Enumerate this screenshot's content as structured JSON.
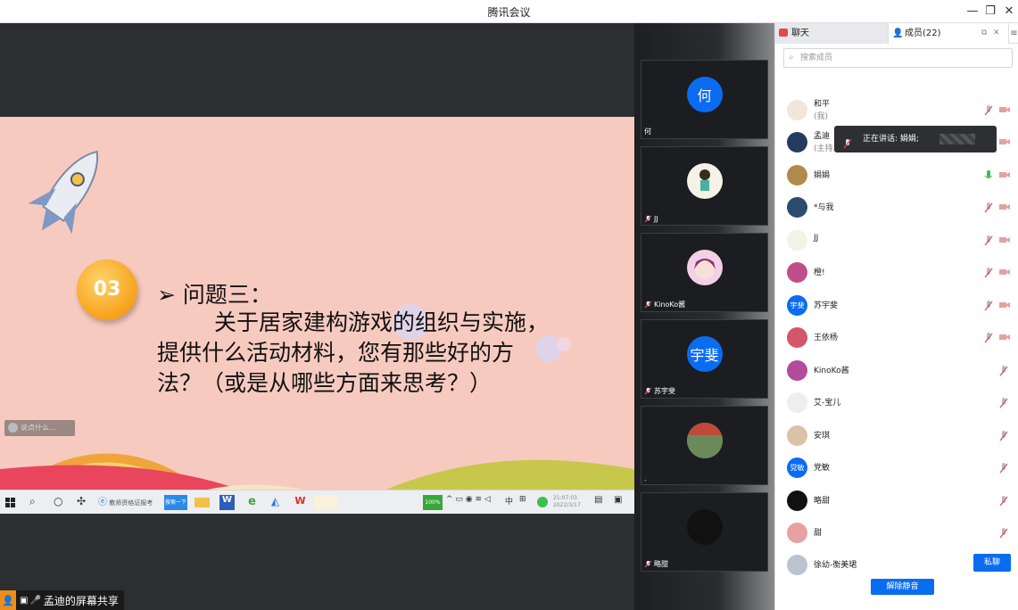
{
  "window": {
    "title": "腾讯会议",
    "controls": {
      "minimize": "—",
      "restore": "❐",
      "close": "✕"
    }
  },
  "slide": {
    "badge": "03",
    "heading": "➢ 问题三：",
    "body_line1": "关于居家建构游戏的组织与实施，",
    "body_line2": "提供什么活动材料，您有那些好的方",
    "body_line3": "法？（或是从哪些方面来思考？）",
    "chat_hint": "说点什么…",
    "taskbar": {
      "search_btn": "搜索一下",
      "tab_label": "教师资格证报考",
      "battery": "100%",
      "ime": "中",
      "time": "21:07:03",
      "date": "2022/3/17"
    }
  },
  "share_label": "孟迪的屏幕共享",
  "video_tiles": [
    {
      "avatar_text": "何",
      "name": "何",
      "color": "#0a6cf0"
    },
    {
      "avatar_text": "",
      "name": "JJ",
      "color": "#f4f1e6"
    },
    {
      "avatar_text": "",
      "name": "KinoKo酱",
      "color": "#f2d0e6"
    },
    {
      "avatar_text": "宇斐",
      "name": "苏宇斐",
      "color": "#0a6cf0"
    },
    {
      "avatar_text": "",
      "name": ".",
      "color": "#8d8a80"
    },
    {
      "avatar_text": "",
      "name": "略甜",
      "color": "#111111"
    }
  ],
  "panel": {
    "tab_chat": "聊天",
    "tab_members": "成员(22)",
    "search_placeholder": "搜索成员",
    "tooltip": "正在讲话: 娟娟;",
    "members": [
      {
        "name": "和平",
        "role": "(我)",
        "av": "#f2e6d8"
      },
      {
        "name": "孟迪",
        "role": "(主持人)",
        "av": "#243a5e"
      },
      {
        "name": "娟娟",
        "role": "",
        "av": "#b08a4a"
      },
      {
        "name": "*与我",
        "role": "",
        "av": "#2b4c6e"
      },
      {
        "name": "JJ",
        "role": "",
        "av": "#f4f1e6"
      },
      {
        "name": "橙!",
        "role": "",
        "av": "#c04e8a"
      },
      {
        "name": "苏宇斐",
        "role": "",
        "av": "#0a6cf0",
        "text": "宇斐"
      },
      {
        "name": "王依杨",
        "role": "",
        "av": "#d4566a"
      },
      {
        "name": "KinoKo酱",
        "role": "",
        "av": "#b34a9a"
      },
      {
        "name": "艾-宝儿",
        "role": "",
        "av": "#eeeeee"
      },
      {
        "name": "安琪",
        "role": "",
        "av": "#d9c2a8"
      },
      {
        "name": "党敏",
        "role": "",
        "av": "#0a6cf0",
        "text": "党敏"
      },
      {
        "name": "略甜",
        "role": "",
        "av": "#111111"
      },
      {
        "name": "甜",
        "role": "",
        "av": "#e8a0a0"
      },
      {
        "name": "徐幼-衡美珺",
        "role": "",
        "av": "#b9c4d0"
      }
    ],
    "private_chat": "私聊",
    "unmute_all": "解除静音"
  },
  "colors": {
    "accent": "#0a6cf0",
    "slide_bg": "#f7cac0",
    "badge": "#f7a21b",
    "muted_red": "#e05050",
    "mic_green": "#3ac050"
  }
}
